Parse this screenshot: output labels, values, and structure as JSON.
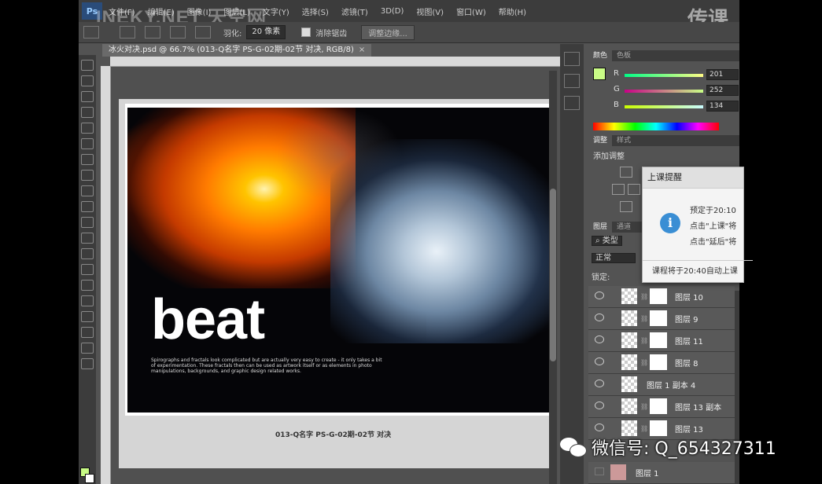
{
  "menubar": {
    "logo": "Ps",
    "items": [
      "文件(F)",
      "编辑(E)",
      "图像(I)",
      "图层(L)",
      "文字(Y)",
      "选择(S)",
      "滤镜(T)",
      "3D(D)",
      "视图(V)",
      "窗口(W)",
      "帮助(H)"
    ],
    "watermark": "INEKY.NET 天空网",
    "brand": "传课"
  },
  "options": {
    "feather_label": "羽化:",
    "feather_value": "20 像素",
    "antialias_label": "消除锯齿",
    "refine_edge_button": "调整边缘..."
  },
  "document": {
    "tab_title": "冰火对决.psd @ 66.7% (013-Q名字 PS-G-02期-02节   对决, RGB/8)",
    "artwork_word": "beat",
    "artwork_blurb": "Spirographs and fractals look complicated but are actually very easy to create - it only takes a bit of experimentation. These fractals then can be used as artwork itself or as elements in photo manipulations, backgrounds, and graphic design related works.",
    "caption": "013-Q名字 PS-G-02期-02节   对决"
  },
  "color_panel": {
    "tabs": [
      "颜色",
      "色板"
    ],
    "r_label": "R",
    "g_label": "G",
    "b_label": "B",
    "r": "201",
    "g": "252",
    "b": "134",
    "fg_color": "#c9fc86"
  },
  "adjust_panel": {
    "tabs": [
      "调整",
      "样式"
    ],
    "title": "添加调整"
  },
  "layers_panel": {
    "tabs": [
      "图层",
      "通道"
    ],
    "kind_filter": "类型",
    "blend_mode": "正常",
    "lock_label": "锁定:",
    "layers": [
      {
        "name": "图层 10"
      },
      {
        "name": "图层 9"
      },
      {
        "name": "图层 11"
      },
      {
        "name": "图层 8"
      },
      {
        "name": "图层 1 副本 4"
      },
      {
        "name": "图层 13 副本"
      },
      {
        "name": "图层 13"
      },
      {
        "name": "图层 1"
      }
    ]
  },
  "popup": {
    "title": "上课提醒",
    "line1": "预定于20:10",
    "line2": "点击\"上课\"将",
    "line3": "点击\"延后\"将",
    "footer": "课程将于20:40自动上课"
  },
  "overlay": {
    "wechat_text": "微信号: Q_654327311"
  }
}
